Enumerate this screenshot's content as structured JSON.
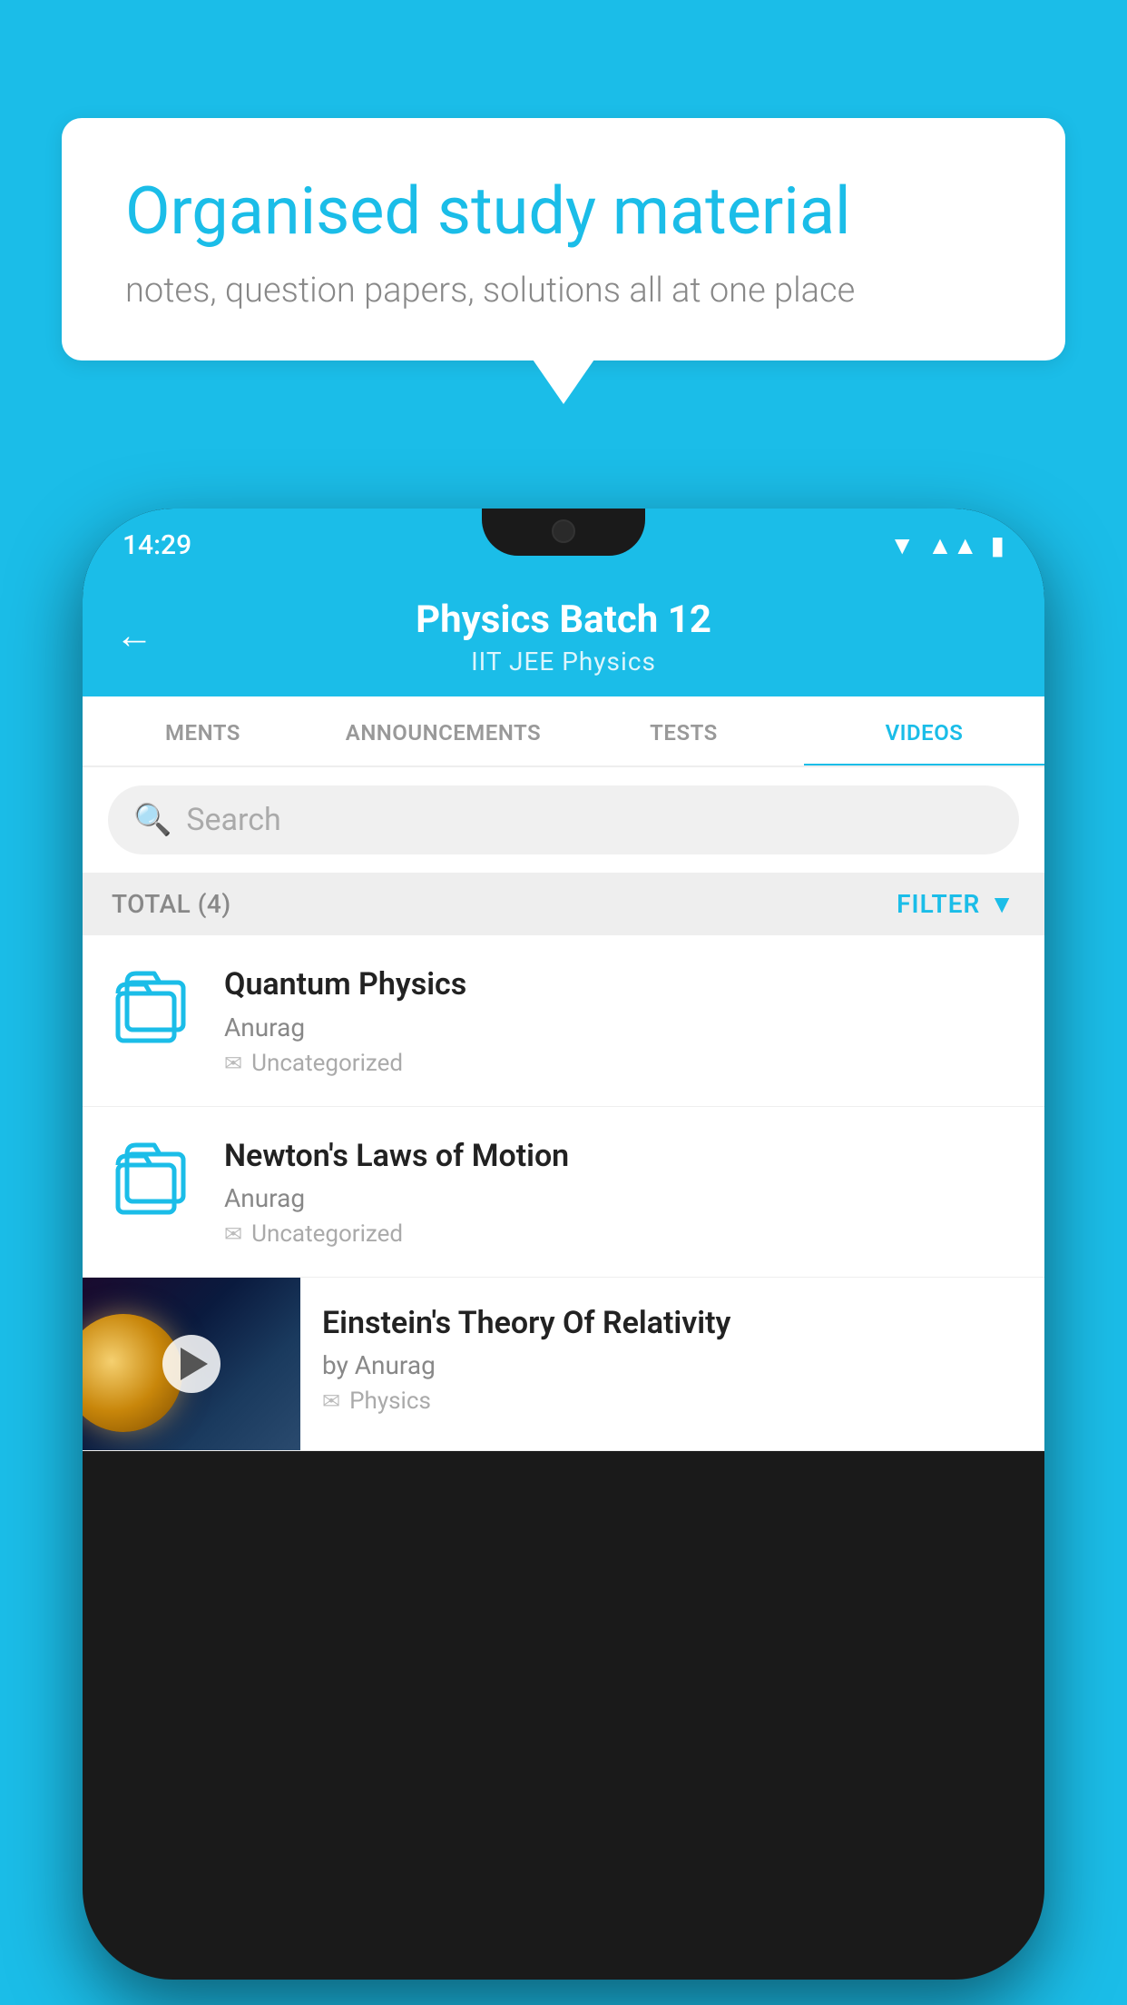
{
  "background_color": "#1BBDE8",
  "bubble": {
    "title": "Organised study material",
    "subtitle": "notes, question papers, solutions all at one place"
  },
  "phone": {
    "status_bar": {
      "time": "14:29",
      "wifi": "▾",
      "signal": "▴▴",
      "battery": "▮"
    },
    "header": {
      "title": "Physics Batch 12",
      "subtitle": "IIT JEE   Physics",
      "back_label": "←"
    },
    "tabs": [
      {
        "label": "MENTS",
        "active": false
      },
      {
        "label": "ANNOUNCEMENTS",
        "active": false
      },
      {
        "label": "TESTS",
        "active": false
      },
      {
        "label": "VIDEOS",
        "active": true
      }
    ],
    "search": {
      "placeholder": "Search"
    },
    "filter": {
      "total_label": "TOTAL (4)",
      "filter_label": "FILTER"
    },
    "videos": [
      {
        "title": "Quantum Physics",
        "author": "Anurag",
        "tag": "Uncategorized",
        "type": "folder"
      },
      {
        "title": "Newton's Laws of Motion",
        "author": "Anurag",
        "tag": "Uncategorized",
        "type": "folder"
      },
      {
        "title": "Einstein's Theory Of Relativity",
        "author": "by Anurag",
        "tag": "Physics",
        "type": "video"
      }
    ]
  }
}
